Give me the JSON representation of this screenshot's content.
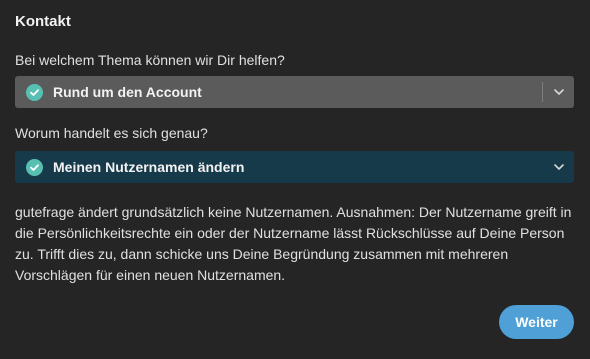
{
  "dialog": {
    "title": "Kontakt"
  },
  "topic": {
    "label": "Bei welchem Thema können wir Dir helfen?",
    "selected": "Rund um den Account"
  },
  "subtopic": {
    "label": "Worum handelt es sich genau?",
    "selected": "Meinen Nutzernamen ändern"
  },
  "info_text": "gutefrage ändert grundsätzlich keine Nutzernamen. Ausnahmen: Der Nutzername greift in die Persönlichkeitsrechte ein oder der Nutzername lässt Rückschlüsse auf Deine Person zu. Trifft dies zu, dann schicke uns Deine Begründung zusammen mit mehreren Vorschlägen für einen neuen Nutzernamen.",
  "actions": {
    "next_label": "Weiter"
  },
  "icons": {
    "check": "check-circle-icon",
    "chevron": "chevron-down-icon"
  },
  "colors": {
    "background": "#252525",
    "select_default": "#5b5b5b",
    "select_active": "#173a4b",
    "check": "#57c0b2",
    "primary_button": "#4ea0d6"
  }
}
